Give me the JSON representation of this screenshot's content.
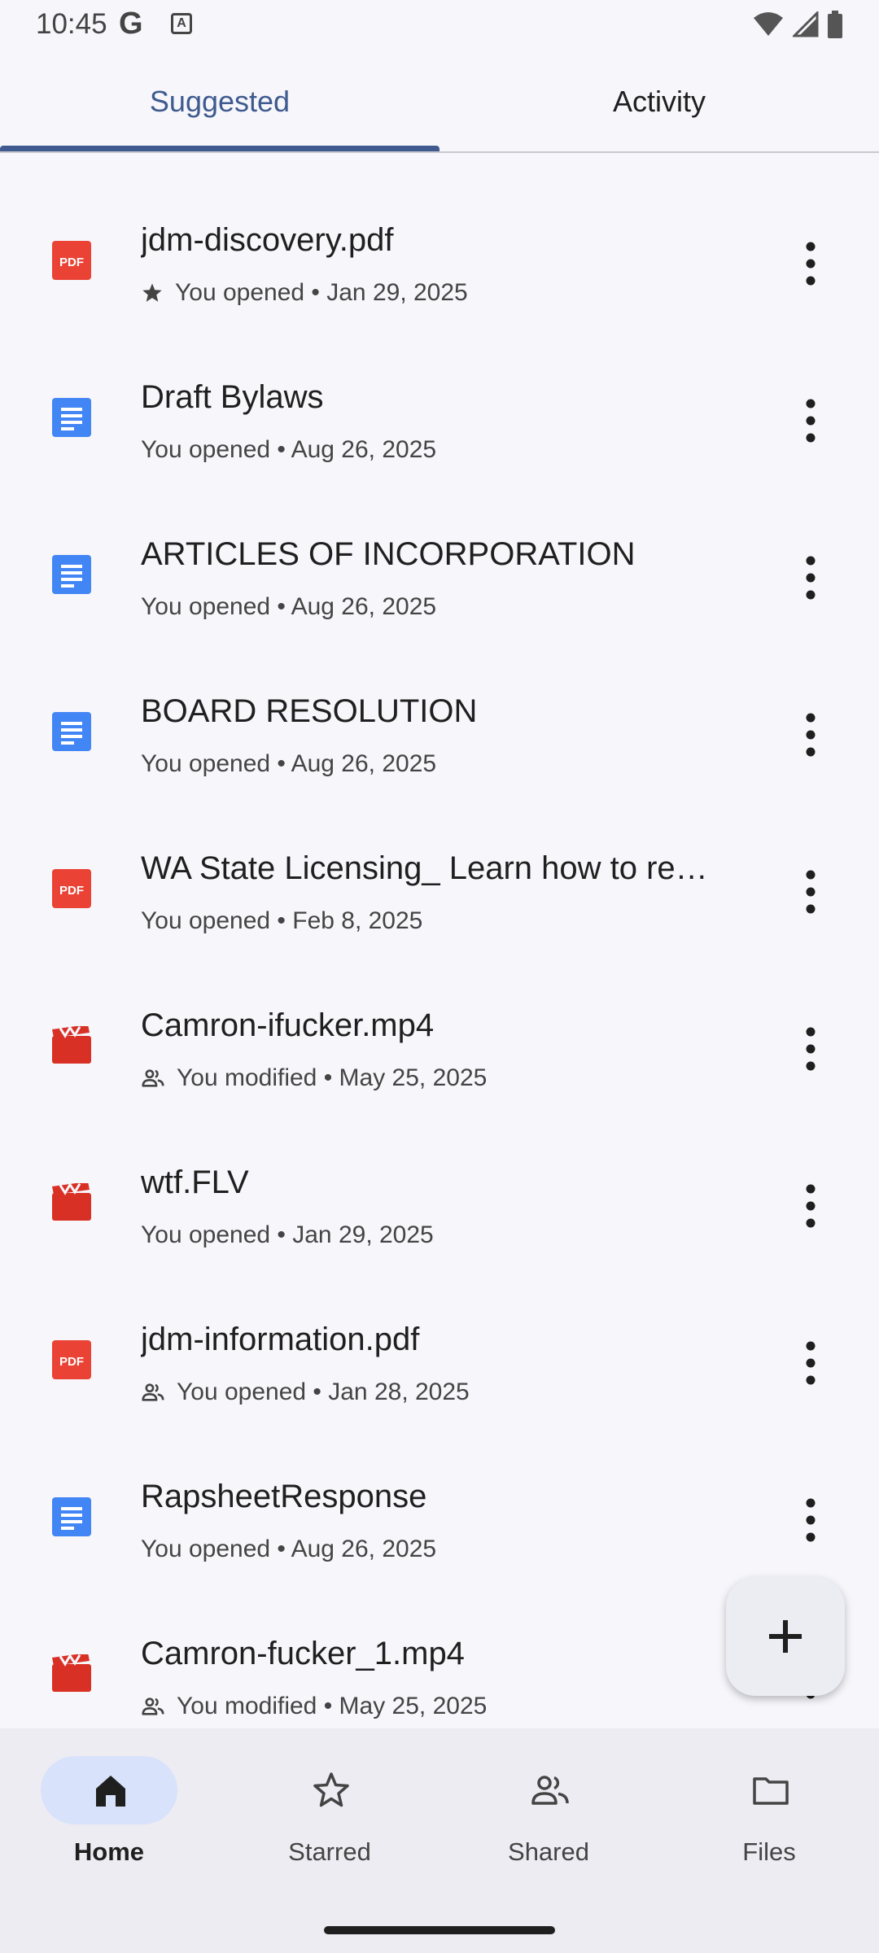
{
  "status_bar": {
    "time": "10:45",
    "g_label": "G",
    "a_label": "A"
  },
  "tabs": [
    {
      "label": "Suggested",
      "selected": true
    },
    {
      "label": "Activity",
      "selected": false
    }
  ],
  "files": [
    {
      "name": "jdm-discovery.pdf",
      "type": "pdf",
      "meta_icon": "star-icon",
      "meta": "You opened • Jan 29, 2025"
    },
    {
      "name": "Draft Bylaws",
      "type": "doc",
      "meta_icon": "",
      "meta": "You opened • Aug 26, 2025"
    },
    {
      "name": "ARTICLES OF INCORPORATION",
      "type": "doc",
      "meta_icon": "",
      "meta": "You opened • Aug 26, 2025"
    },
    {
      "name": "BOARD RESOLUTION",
      "type": "doc",
      "meta_icon": "",
      "meta": "You opened • Aug 26, 2025"
    },
    {
      "name": "WA State Licensing_ Learn how to re…",
      "type": "pdf",
      "meta_icon": "",
      "meta": "You opened • Feb 8, 2025"
    },
    {
      "name": "Camron-ifucker.mp4",
      "type": "video",
      "meta_icon": "shared-people-icon",
      "meta": "You modified • May 25, 2025"
    },
    {
      "name": "wtf.FLV",
      "type": "video",
      "meta_icon": "",
      "meta": "You opened • Jan 29, 2025"
    },
    {
      "name": "jdm-information.pdf",
      "type": "pdf",
      "meta_icon": "shared-people-icon",
      "meta": "You opened • Jan 28, 2025"
    },
    {
      "name": "RapsheetResponse",
      "type": "doc",
      "meta_icon": "",
      "meta": "You opened • Aug 26, 2025"
    },
    {
      "name": "Camron-fucker_1.mp4",
      "type": "video",
      "meta_icon": "shared-people-icon",
      "meta": "You modified • May 25, 2025"
    }
  ],
  "fab": {
    "icon": "plus-icon"
  },
  "bottom_nav": [
    {
      "label": "Home",
      "icon": "home-icon",
      "active": true
    },
    {
      "label": "Starred",
      "icon": "star-outline-icon",
      "active": false
    },
    {
      "label": "Shared",
      "icon": "shared-people-icon",
      "active": false
    },
    {
      "label": "Files",
      "icon": "folder-icon",
      "active": false
    }
  ],
  "colors": {
    "accent": "#3f5a8f",
    "pdf_red": "#ea4335",
    "doc_blue": "#4285f4",
    "video_red": "#d93025",
    "nav_active_pill": "#d9e2fb",
    "background": "#f6f6fb"
  }
}
